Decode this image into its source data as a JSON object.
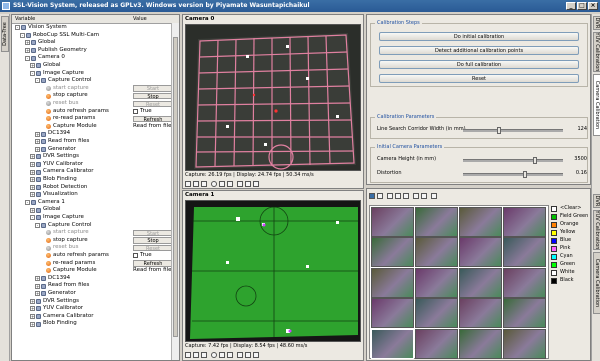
{
  "window": {
    "title": "SSL-Vision System, released as GPLv3. Windows version by Piyamate Wasuntapichaikul",
    "controls": [
      "_",
      "□",
      "×"
    ]
  },
  "left_tabs": [
    "Data-Tree"
  ],
  "tree": {
    "header": {
      "variable": "Variable",
      "value": "Value"
    },
    "rows": [
      {
        "indent": 0,
        "label": "Vision System",
        "icon": "gear-icon",
        "expander": "-"
      },
      {
        "indent": 1,
        "label": "RoboCup SSL Multi-Cam",
        "icon": "gear-icon",
        "expander": "-"
      },
      {
        "indent": 2,
        "label": "Global",
        "icon": "gear-icon",
        "expander": "+"
      },
      {
        "indent": 2,
        "label": "Publish Geometry",
        "icon": "gear-icon",
        "expander": "+"
      },
      {
        "indent": 2,
        "label": "Camera 0",
        "icon": "gear-icon",
        "expander": "-"
      },
      {
        "indent": 3,
        "label": "Global",
        "icon": "gear-icon",
        "expander": "+"
      },
      {
        "indent": 3,
        "label": "Image Capture",
        "icon": "gear-icon",
        "expander": "-"
      },
      {
        "indent": 4,
        "label": "Capture Control",
        "icon": "gear-icon",
        "expander": "-"
      },
      {
        "indent": 5,
        "label": "start capture",
        "icon": "gray-trigger-icon",
        "button": "Start",
        "disabled": true
      },
      {
        "indent": 5,
        "label": "stop capture",
        "icon": "orange-trigger-icon",
        "button": "Stop",
        "disabled": false
      },
      {
        "indent": 5,
        "label": "reset bus",
        "icon": "gray-trigger-icon",
        "button": "Reset",
        "disabled": true
      },
      {
        "indent": 5,
        "label": "auto refresh params",
        "icon": "orange-trigger-icon",
        "value": "True",
        "checkbox": true
      },
      {
        "indent": 5,
        "label": "re-read params",
        "icon": "orange-trigger-icon",
        "button": "Refresh",
        "disabled": false
      },
      {
        "indent": 5,
        "label": "Capture Module",
        "icon": "orange-trigger-icon",
        "value": "Read from files"
      },
      {
        "indent": 4,
        "label": "DC1394",
        "icon": "gear-icon",
        "expander": "+"
      },
      {
        "indent": 4,
        "label": "Read from files",
        "icon": "gear-icon",
        "expander": "+"
      },
      {
        "indent": 4,
        "label": "Generator",
        "icon": "gear-icon",
        "expander": "+"
      },
      {
        "indent": 3,
        "label": "DVR Settings",
        "icon": "gear-icon",
        "expander": "+"
      },
      {
        "indent": 3,
        "label": "YUV Calibrator",
        "icon": "gear-icon",
        "expander": "+"
      },
      {
        "indent": 3,
        "label": "Camera Calibrator",
        "icon": "gear-icon",
        "expander": "+"
      },
      {
        "indent": 3,
        "label": "Blob Finding",
        "icon": "gear-icon",
        "expander": "+"
      },
      {
        "indent": 3,
        "label": "Robot Detection",
        "icon": "gear-icon",
        "expander": "+"
      },
      {
        "indent": 3,
        "label": "Visualization",
        "icon": "gear-icon",
        "expander": "+"
      },
      {
        "indent": 2,
        "label": "Camera 1",
        "icon": "gear-icon",
        "expander": "-"
      },
      {
        "indent": 3,
        "label": "Global",
        "icon": "gear-icon",
        "expander": "+"
      },
      {
        "indent": 3,
        "label": "Image Capture",
        "icon": "gear-icon",
        "expander": "-"
      },
      {
        "indent": 4,
        "label": "Capture Control",
        "icon": "gear-icon",
        "expander": "-"
      },
      {
        "indent": 5,
        "label": "start capture",
        "icon": "gray-trigger-icon",
        "button": "Start",
        "disabled": true
      },
      {
        "indent": 5,
        "label": "stop capture",
        "icon": "orange-trigger-icon",
        "button": "Stop",
        "disabled": false
      },
      {
        "indent": 5,
        "label": "reset bus",
        "icon": "gray-trigger-icon",
        "button": "Reset",
        "disabled": true
      },
      {
        "indent": 5,
        "label": "auto refresh params",
        "icon": "orange-trigger-icon",
        "value": "True",
        "checkbox": true
      },
      {
        "indent": 5,
        "label": "re-read params",
        "icon": "orange-trigger-icon",
        "button": "Refresh",
        "disabled": false
      },
      {
        "indent": 5,
        "label": "Capture Module",
        "icon": "orange-trigger-icon",
        "value": "Read from files"
      },
      {
        "indent": 4,
        "label": "DC1394",
        "icon": "gear-icon",
        "expander": "+"
      },
      {
        "indent": 4,
        "label": "Read from files",
        "icon": "gear-icon",
        "expander": "+"
      },
      {
        "indent": 4,
        "label": "Generator",
        "icon": "gear-icon",
        "expander": "+"
      },
      {
        "indent": 3,
        "label": "DVR Settings",
        "icon": "gear-icon",
        "expander": "+"
      },
      {
        "indent": 3,
        "label": "YUV Calibrator",
        "icon": "gear-icon",
        "expander": "+"
      },
      {
        "indent": 3,
        "label": "Camera Calibrator",
        "icon": "gear-icon",
        "expander": "+"
      },
      {
        "indent": 3,
        "label": "Blob Finding",
        "icon": "gear-icon",
        "expander": "+"
      }
    ]
  },
  "camera0": {
    "title": "Camera 0",
    "status": "Capture: 26.19 fps | Display: 24.74 fps | 50.34 ms/s"
  },
  "camera1": {
    "title": "Camera 1",
    "status": "Capture: 7.42 fps | Display: 8.54 fps | 48.60 ms/s"
  },
  "calibration": {
    "steps_title": "Calibration Steps",
    "buttons": [
      "Do initial calibration",
      "Detect additional calibration points",
      "Do full calibration",
      "Reset"
    ],
    "params_title": "Calibration Parameters",
    "line_search": {
      "label": "Line Search Corridor Width (in mm)",
      "value": "124",
      "fraction": 0.36
    },
    "initial_title": "Initial Camera Parameters",
    "camera_height": {
      "label": "Camera Height (in mm)",
      "value": "3500",
      "fraction": 0.72
    },
    "distortion": {
      "label": "Distortion",
      "value": "0.16",
      "fraction": 0.62
    }
  },
  "color_legend": [
    {
      "name": "<Clear>",
      "color": "#ffffff"
    },
    {
      "name": "Field Green",
      "color": "#00c000"
    },
    {
      "name": "Orange",
      "color": "#ff8000"
    },
    {
      "name": "Yellow",
      "color": "#ffff00"
    },
    {
      "name": "Blue",
      "color": "#0000ff"
    },
    {
      "name": "Pink",
      "color": "#ff60ff"
    },
    {
      "name": "Cyan",
      "color": "#00ffff"
    },
    {
      "name": "Green",
      "color": "#00ff00"
    },
    {
      "name": "White",
      "color": "#ffffff"
    },
    {
      "name": "Black",
      "color": "#000000"
    }
  ],
  "right_tabs_top": [
    "DVR",
    "YUV Calibration",
    "Camera Calibration"
  ],
  "right_tabs_bottom": [
    "DVR",
    "YUV Calibration",
    "Camera Calibration"
  ],
  "colors": {
    "titlebar": "#2a5a95",
    "field_green": "#2ea32e",
    "accent_blue": "#2050a0"
  }
}
